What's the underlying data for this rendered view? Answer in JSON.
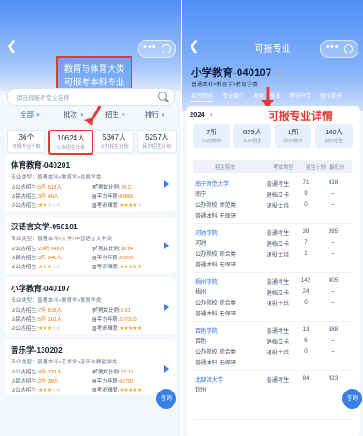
{
  "left": {
    "redbox_line1": "教育与体育大类",
    "redbox_line2": "可报考本科专业",
    "search_placeholder": "请选择报考专业名称",
    "filters": [
      {
        "label": "全部"
      },
      {
        "label": "批次"
      },
      {
        "label": "招生"
      },
      {
        "label": "排行"
      }
    ],
    "stats": [
      {
        "value": "36个",
        "label": "可报专业个数"
      },
      {
        "value": "10624人",
        "label": "公办招生计划"
      },
      {
        "value": "5367人",
        "label": "公办招生计划"
      },
      {
        "value": "5257人",
        "label": "民办招生计划"
      }
    ],
    "cards": [
      {
        "title": "体育教育-040201",
        "type": "专业类型：普通本科>教育学>体育学类",
        "r1": "公办招生:",
        "r1v": "6所 518人",
        "r1b": "男女比例:",
        "r1bv": "79:21",
        "r2": "民办招生:",
        "r2v": "3所 46人",
        "r2b": "平均年薪:",
        "r2bv": "88866",
        "r3": "公办招生:",
        "r3b": "考研难度:",
        "s1": 2,
        "s2": 4
      },
      {
        "title": "汉语言文学-050101",
        "type": "专业类型：普通本科>文学>中国语言文学类",
        "r1": "公办招生:",
        "r1v": "23所 648人",
        "r1b": "男女比例:",
        "r1bv": "16:84",
        "r2": "民办招生:",
        "r2v": "3所 341人",
        "r2b": "平均年薪:",
        "r2bv": "86930",
        "r3": "公办招生:",
        "r3b": "考研难度:",
        "s1": 3,
        "s2": 5
      },
      {
        "title": "小学教育-040107",
        "type": "专业类型：普通本科>教育学>教育学类",
        "r1": "公办招生:",
        "r1v": "7所 838人",
        "r1b": "男女比例:",
        "r1bv": "9:91",
        "r2": "民办招生:",
        "r2v": "5所 160人",
        "r2b": "平均年薪:",
        "r2bv": "107310",
        "r3": "公办招生:",
        "r3b": "考研难度:",
        "s1": 3,
        "s2": 5
      },
      {
        "title": "音乐学-130202",
        "type": "专业类型：普通本科>艺术学>音乐与舞蹈学类",
        "r1": "公办招生:",
        "r1v": "4所 218人",
        "r1b": "男女比例:",
        "r1bv": "27:73",
        "r2": "民办招生:",
        "r2v": "2所 38人",
        "r2b": "平均年薪:",
        "r2bv": "66783",
        "r3": "公办招生:",
        "r3b": "考研难度:",
        "s1": 3,
        "s2": 5
      }
    ],
    "fab_label": "咨询"
  },
  "right": {
    "nav_title": "可报专业",
    "major_title": "小学教育-040107",
    "major_sub": "普通本科>教育学>教育学类",
    "tabs": [
      "招生院校",
      "专业简介",
      "考研",
      "就业",
      "考研升学",
      "就业前景"
    ],
    "year": "2024",
    "red_label": "可报专业详情",
    "stats": [
      {
        "value": "7所",
        "label": "公办院校"
      },
      {
        "value": "639人",
        "label": "公办招生"
      },
      {
        "value": "1所",
        "label": "民办院校"
      },
      {
        "value": "140人",
        "label": "民办招生"
      }
    ],
    "table_headers": [
      "招生院校",
      "考试类型",
      "招生计划",
      "最低分"
    ],
    "schools": [
      {
        "name": "南宁师范大学",
        "city": "南宁",
        "tags1": "公办院校  师范类",
        "tags2": "普通本科  无保研",
        "rows": [
          [
            "普通考生",
            "71",
            "438"
          ],
          [
            "建档立卡",
            "9",
            "–"
          ],
          [
            "退役士兵",
            "0",
            "–"
          ]
        ]
      },
      {
        "name": "河池学院",
        "city": "河池",
        "tags1": "公办院校  综合类",
        "tags2": "普通本科  无保研",
        "rows": [
          [
            "普通考生",
            "38",
            "395"
          ],
          [
            "建档立卡",
            "7",
            "–"
          ],
          [
            "退役士兵",
            "1",
            "–"
          ]
        ]
      },
      {
        "name": "梧州学院",
        "city": "梧州",
        "tags1": "公办院校  综合类",
        "tags2": "普通本科  无保研",
        "rows": [
          [
            "普通考生",
            "142",
            "405"
          ],
          [
            "建档立卡",
            "24",
            "–"
          ],
          [
            "退役士兵",
            "0",
            "–"
          ]
        ]
      },
      {
        "name": "百色学院",
        "city": "百色",
        "tags1": "公办院校  综合类",
        "tags2": "普通本科  无保研",
        "rows": [
          [
            "普通考生",
            "13",
            "388"
          ],
          [
            "建档立卡",
            "6",
            "–"
          ],
          [
            "退役士兵",
            "0",
            "–"
          ]
        ]
      },
      {
        "name": "北部湾大学",
        "city": "钦州",
        "tags1": "",
        "tags2": "",
        "rows": [
          [
            "普通考生",
            "84",
            "423"
          ]
        ]
      }
    ],
    "fab_label": "咨询"
  },
  "colors": {
    "accent": "#3a7ee8",
    "highlight": "#e53935",
    "orange": "#e07a16"
  }
}
